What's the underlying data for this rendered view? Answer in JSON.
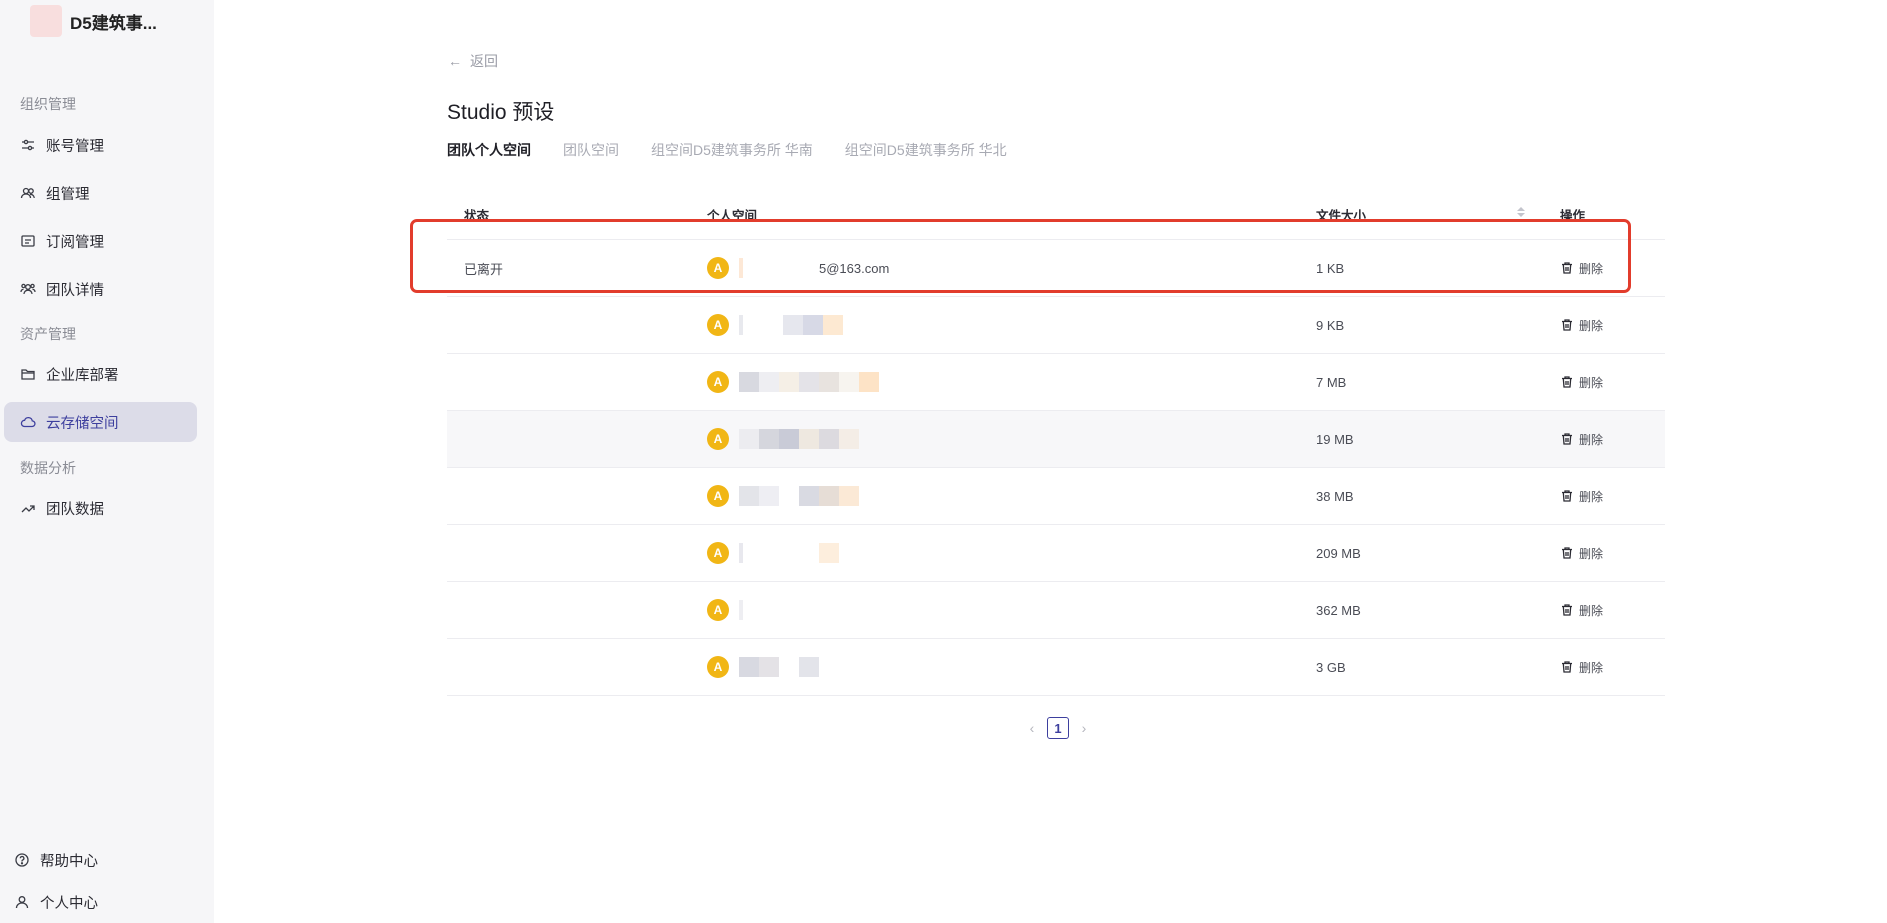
{
  "org": {
    "name": "D5建筑事..."
  },
  "sidebar": {
    "sections": [
      {
        "title": "组织管理",
        "items": [
          {
            "label": "账号管理",
            "icon": "sliders-icon"
          },
          {
            "label": "组管理",
            "icon": "users-icon"
          },
          {
            "label": "订阅管理",
            "icon": "card-icon"
          },
          {
            "label": "团队详情",
            "icon": "team-icon"
          }
        ]
      },
      {
        "title": "资产管理",
        "items": [
          {
            "label": "企业库部署",
            "icon": "folder-icon"
          },
          {
            "label": "云存储空间",
            "icon": "cloud-icon",
            "active": true
          }
        ]
      },
      {
        "title": "数据分析",
        "items": [
          {
            "label": "团队数据",
            "icon": "trend-icon"
          }
        ]
      }
    ],
    "bottom": [
      {
        "label": "帮助中心",
        "icon": "help-icon"
      },
      {
        "label": "个人中心",
        "icon": "person-icon"
      }
    ]
  },
  "main": {
    "back_label": "返回",
    "title": "Studio 预设",
    "tabs": [
      {
        "label": "团队个人空间",
        "active": true
      },
      {
        "label": "团队空间"
      },
      {
        "label": "组空间D5建筑事务所 华南"
      },
      {
        "label": "组空间D5建筑事务所 华北"
      }
    ]
  },
  "table": {
    "columns": {
      "status": "状态",
      "space": "个人空间",
      "size": "文件大小",
      "ops": "操作"
    },
    "rows": [
      {
        "status": "已离开",
        "avatar": "A",
        "email": "5@163.com",
        "size": "1 KB",
        "op": "删除"
      },
      {
        "status": "",
        "avatar": "A",
        "email": "",
        "size": "9 KB",
        "op": "删除"
      },
      {
        "status": "",
        "avatar": "A",
        "email": "",
        "size": "7 MB",
        "op": "删除"
      },
      {
        "status": "",
        "avatar": "A",
        "email": "",
        "size": "19 MB",
        "op": "删除"
      },
      {
        "status": "",
        "avatar": "A",
        "email": "",
        "size": "38 MB",
        "op": "删除"
      },
      {
        "status": "",
        "avatar": "A",
        "email": "",
        "size": "209 MB",
        "op": "删除"
      },
      {
        "status": "",
        "avatar": "A",
        "email": "",
        "size": "362 MB",
        "op": "删除"
      },
      {
        "status": "",
        "avatar": "A",
        "email": "",
        "size": "3 GB",
        "op": "删除"
      }
    ]
  },
  "pagination": {
    "current": "1",
    "prev": "‹",
    "next": "›"
  },
  "colors": {
    "accent": "#3d3f9e",
    "avatar": "#f1b615",
    "highlight": "#e23c2c"
  }
}
